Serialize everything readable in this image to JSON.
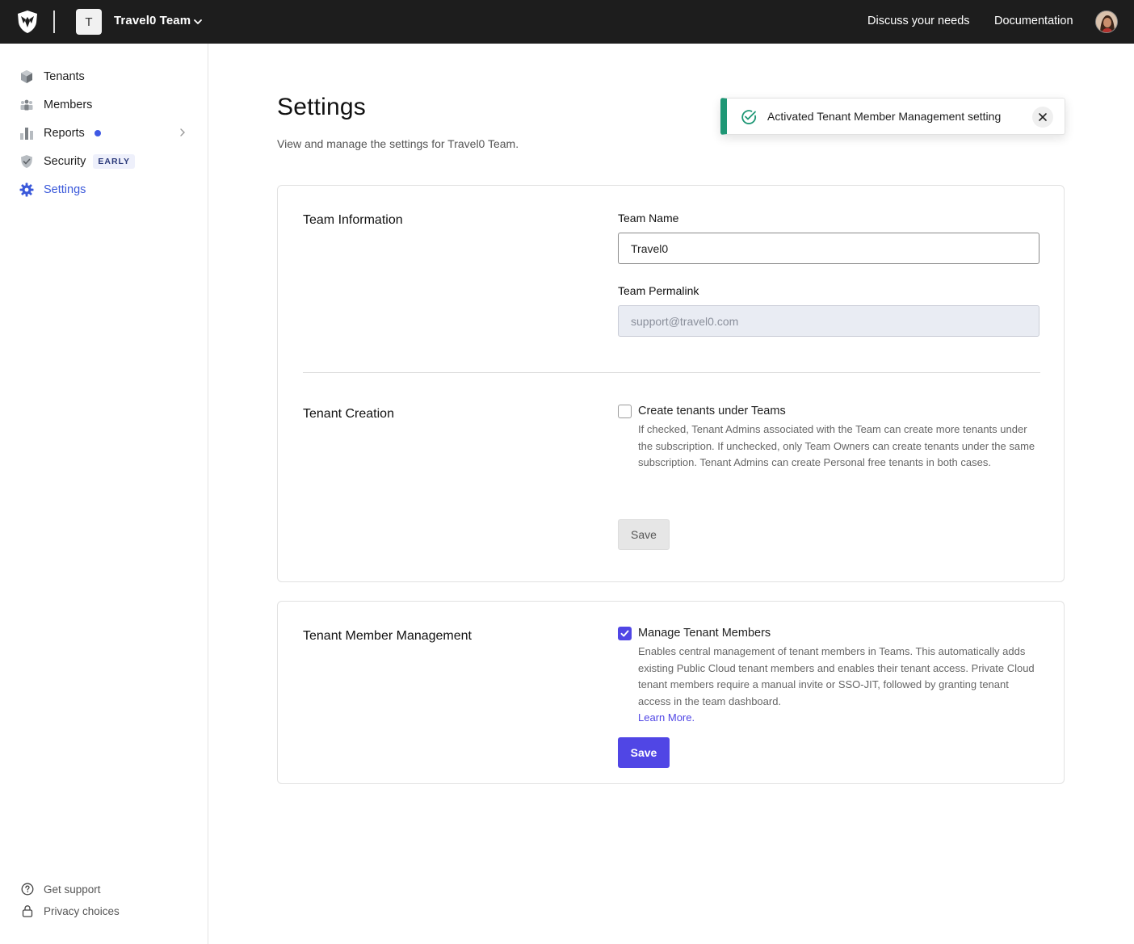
{
  "topbar": {
    "team_initial": "T",
    "team_name": "Travel0 Team",
    "links": {
      "discuss": "Discuss your needs",
      "docs": "Documentation"
    }
  },
  "sidebar": {
    "items": [
      {
        "label": "Tenants",
        "icon": "cube-icon"
      },
      {
        "label": "Members",
        "icon": "members-icon"
      },
      {
        "label": "Reports",
        "icon": "bar-chart-icon"
      },
      {
        "label": "Security",
        "icon": "shield-check-icon",
        "badge": "EARLY"
      },
      {
        "label": "Settings",
        "icon": "gear-icon",
        "active": true
      }
    ],
    "footer": [
      {
        "label": "Get support",
        "icon": "help-circle-icon"
      },
      {
        "label": "Privacy choices",
        "icon": "lock-icon"
      }
    ]
  },
  "page": {
    "title": "Settings",
    "subtitle": "View and manage the settings for Travel0 Team."
  },
  "toast": {
    "message": "Activated Tenant Member Management setting",
    "accent": "#1e9775"
  },
  "team_info": {
    "section_label": "Team Information",
    "name_label": "Team Name",
    "name_value": "Travel0",
    "permalink_label": "Team Permalink",
    "permalink_value": "support@travel0.com"
  },
  "tenant_creation": {
    "section_label": "Tenant Creation",
    "checkbox_label": "Create tenants under Teams",
    "checked": false,
    "description": "If checked, Tenant Admins associated with the Team can create more tenants under the subscription. If unchecked, only Team Owners can create tenants under the same subscription. Tenant Admins can create Personal free tenants in both cases.",
    "save_label": "Save"
  },
  "member_management": {
    "section_label": "Tenant Member Management",
    "checkbox_label": "Manage Tenant Members",
    "checked": true,
    "description": "Enables central management of tenant members in Teams. This automatically adds existing Public Cloud tenant members and enables their tenant access. Private Cloud tenant members require a manual invite or SSO-JIT, followed by granting tenant access in the team dashboard.",
    "learn_more": "Learn More.",
    "save_label": "Save"
  },
  "colors": {
    "accent": "#5046e5",
    "active_nav": "#3b59da",
    "topbar": "#1d1d1d"
  }
}
